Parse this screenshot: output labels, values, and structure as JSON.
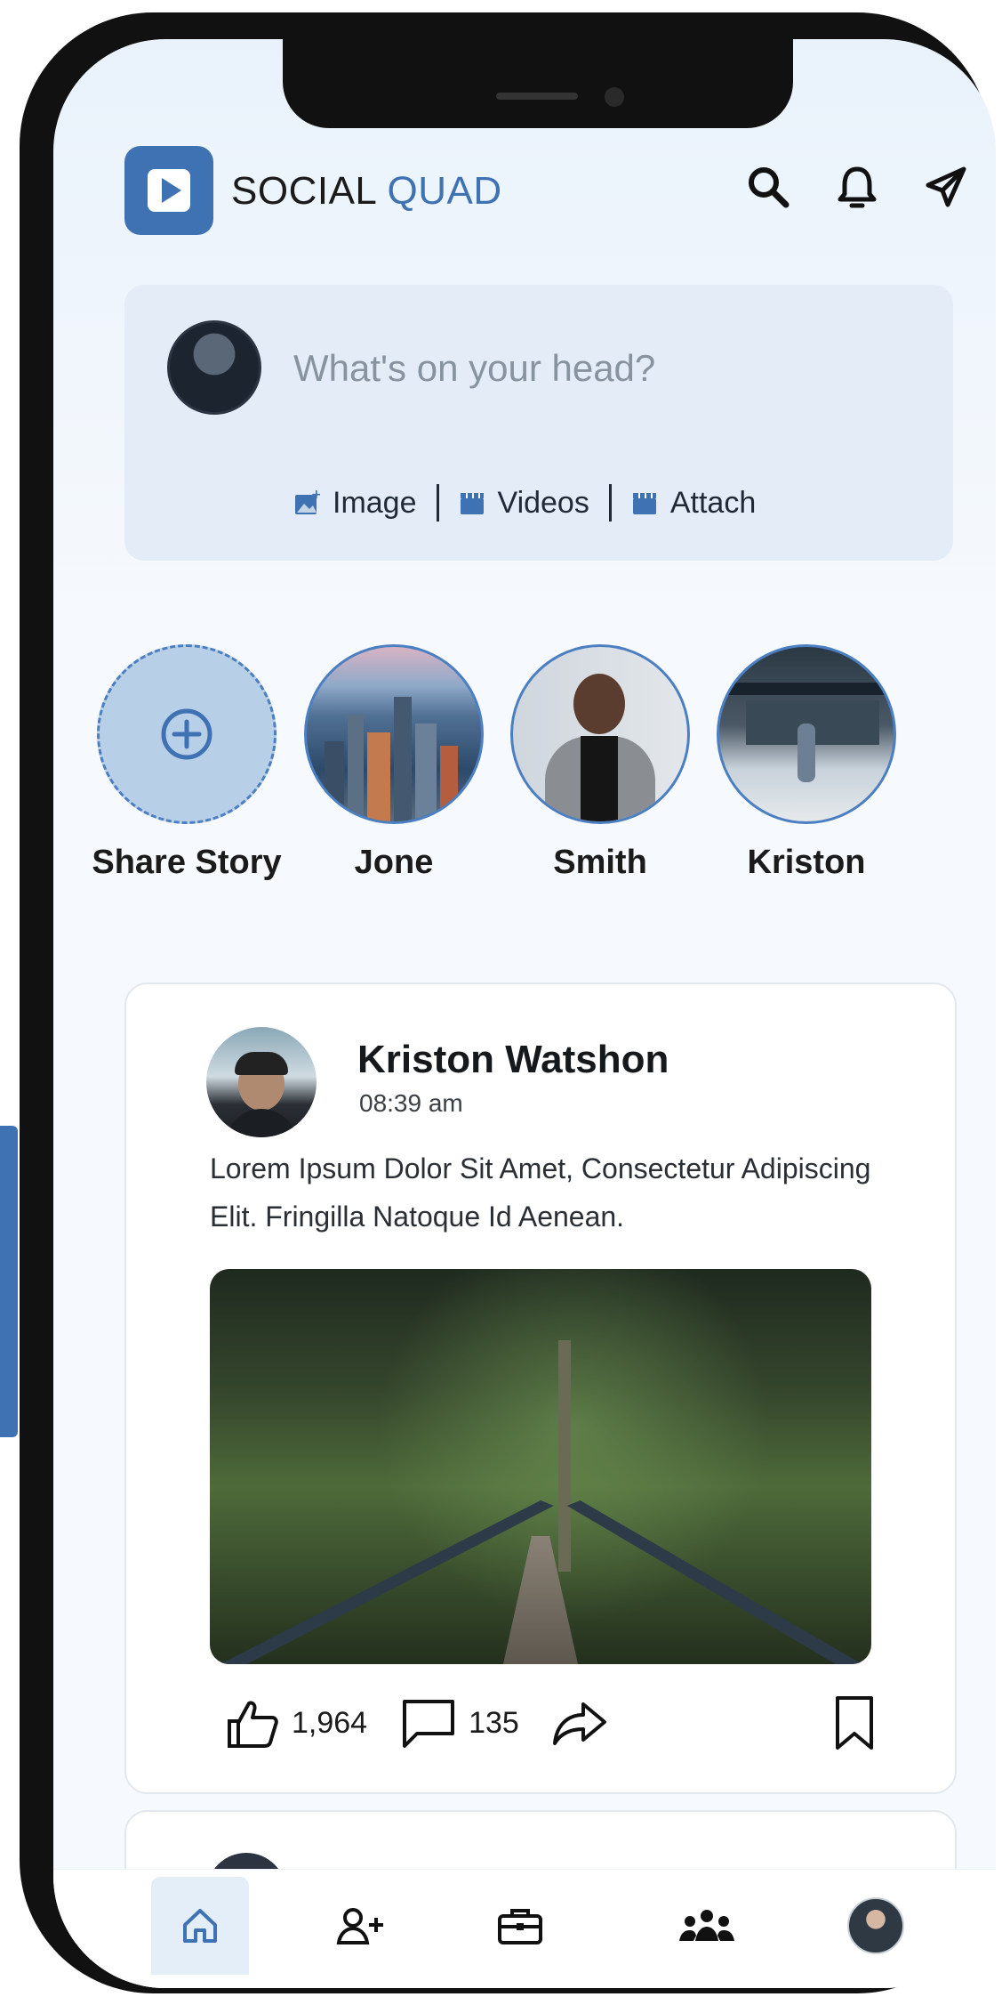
{
  "brand": {
    "name_part1": "SOCIAL",
    "name_part2": "QUAD",
    "accent_color": "#3f72b3"
  },
  "header_icons": [
    "search-icon",
    "bell-icon",
    "send-icon"
  ],
  "composer": {
    "placeholder": "What's on your head?",
    "actions": [
      {
        "label": "Image",
        "icon": "image-icon"
      },
      {
        "label": "Videos",
        "icon": "video-icon"
      },
      {
        "label": "Attach",
        "icon": "attach-icon"
      }
    ]
  },
  "stories": [
    {
      "name": "Share Story",
      "icon": "plus-circle-icon"
    },
    {
      "name": "Jone"
    },
    {
      "name": "Smith"
    },
    {
      "name": "Kriston"
    }
  ],
  "post": {
    "author": "Kriston Watshon",
    "time": "08:39 am",
    "text": "Lorem Ipsum Dolor Sit Amet, Consectetur Adipiscing Elit. Fringilla Natoque Id Aenean.",
    "likes": "1,964",
    "comments": "135"
  },
  "bottom_nav": [
    "home-icon",
    "add-friend-icon",
    "briefcase-icon",
    "groups-icon",
    "profile-avatar"
  ]
}
